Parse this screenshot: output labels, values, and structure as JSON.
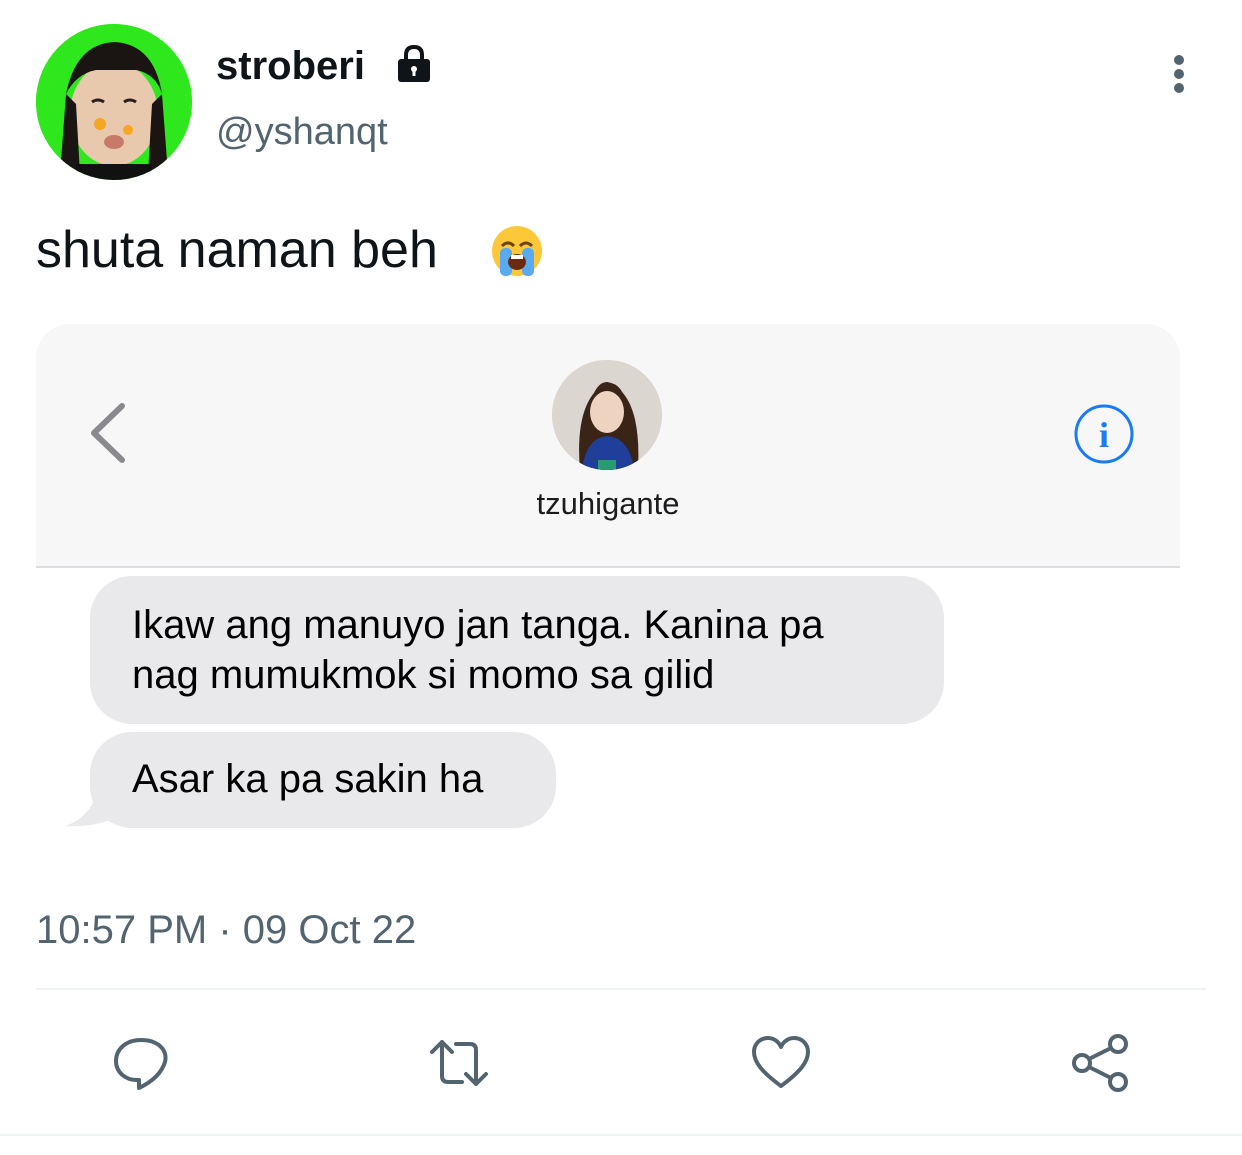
{
  "author": {
    "display_name": "stroberi",
    "handle": "@yshanqt",
    "protected_icon": "lock-icon",
    "avatar_bg": "#2ee81d"
  },
  "tweet": {
    "text": "shuta naman beh",
    "emoji": "loudly-crying-face-emoji",
    "timestamp": "10:57 PM · 09 Oct 22"
  },
  "chat_screenshot": {
    "contact_name": "tzuhigante",
    "messages": [
      {
        "text_line1": "Ikaw ang manuyo jan tanga. Kanina pa",
        "text_line2": "nag mumukmok si momo sa gilid"
      },
      {
        "text": "Asar ka pa sakin ha"
      }
    ],
    "info_color": "#1a7cf5"
  },
  "actions": [
    "reply-icon",
    "retweet-icon",
    "like-icon",
    "share-icon"
  ],
  "colors": {
    "secondary_text": "#536471",
    "bubble": "#e9e9eb",
    "icon": "#536471"
  }
}
